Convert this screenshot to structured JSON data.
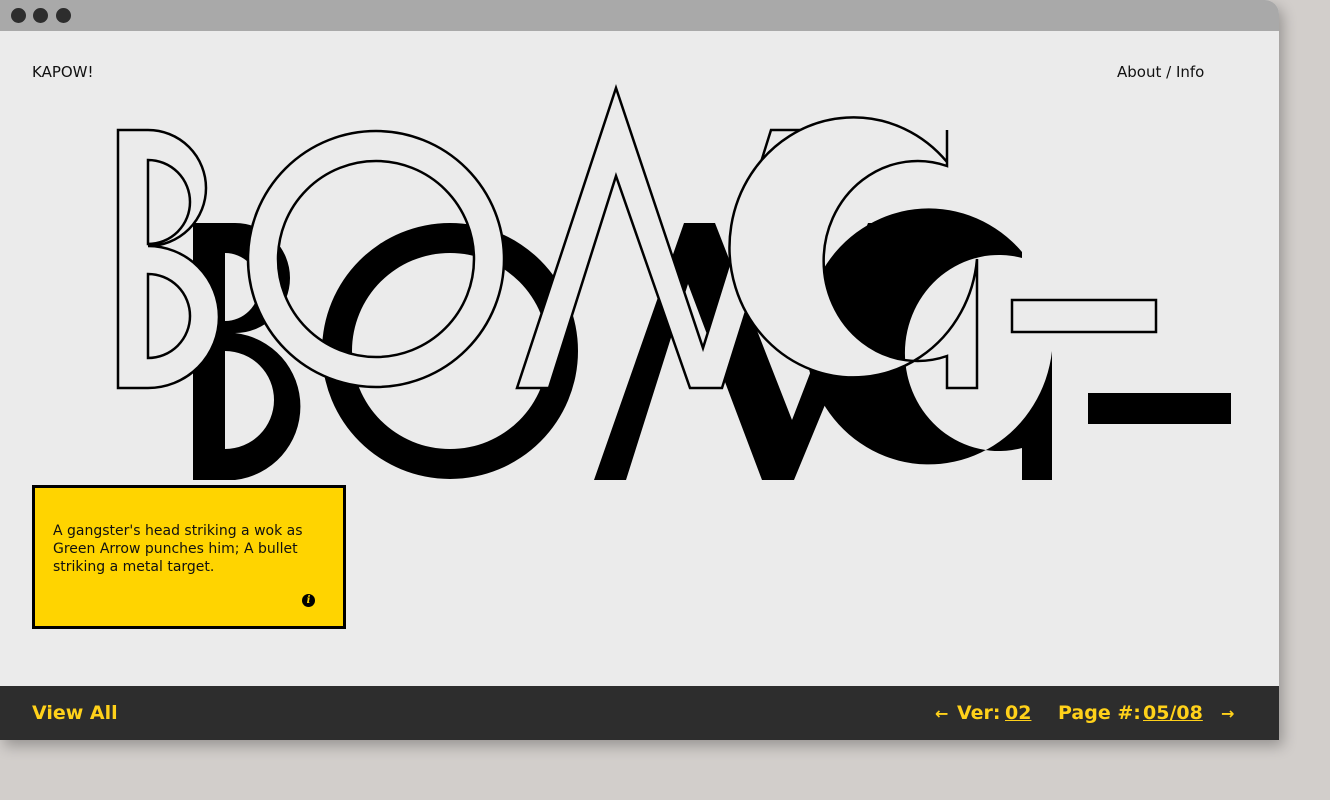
{
  "window": {
    "controls": [
      "close",
      "minimize",
      "zoom"
    ]
  },
  "header": {
    "brand": "KAPOW!",
    "nav_link": "About / Info"
  },
  "hero": {
    "word": "BONG-"
  },
  "caption": {
    "text": "A gangster's head striking a wok as Green Arrow punches him; A bullet striking a metal target.",
    "icon": "info-icon"
  },
  "footer": {
    "view_all": "View All",
    "prev_arrow": "←",
    "version_label": "Ver:",
    "version_value": "02",
    "page_label": "Page #:",
    "page_value": "05/08",
    "next_arrow": "→"
  },
  "colors": {
    "accent": "#ffd400",
    "footer_bg": "#2d2d2d",
    "page_bg": "#ebebeb",
    "chrome": "#a9a9a9"
  }
}
